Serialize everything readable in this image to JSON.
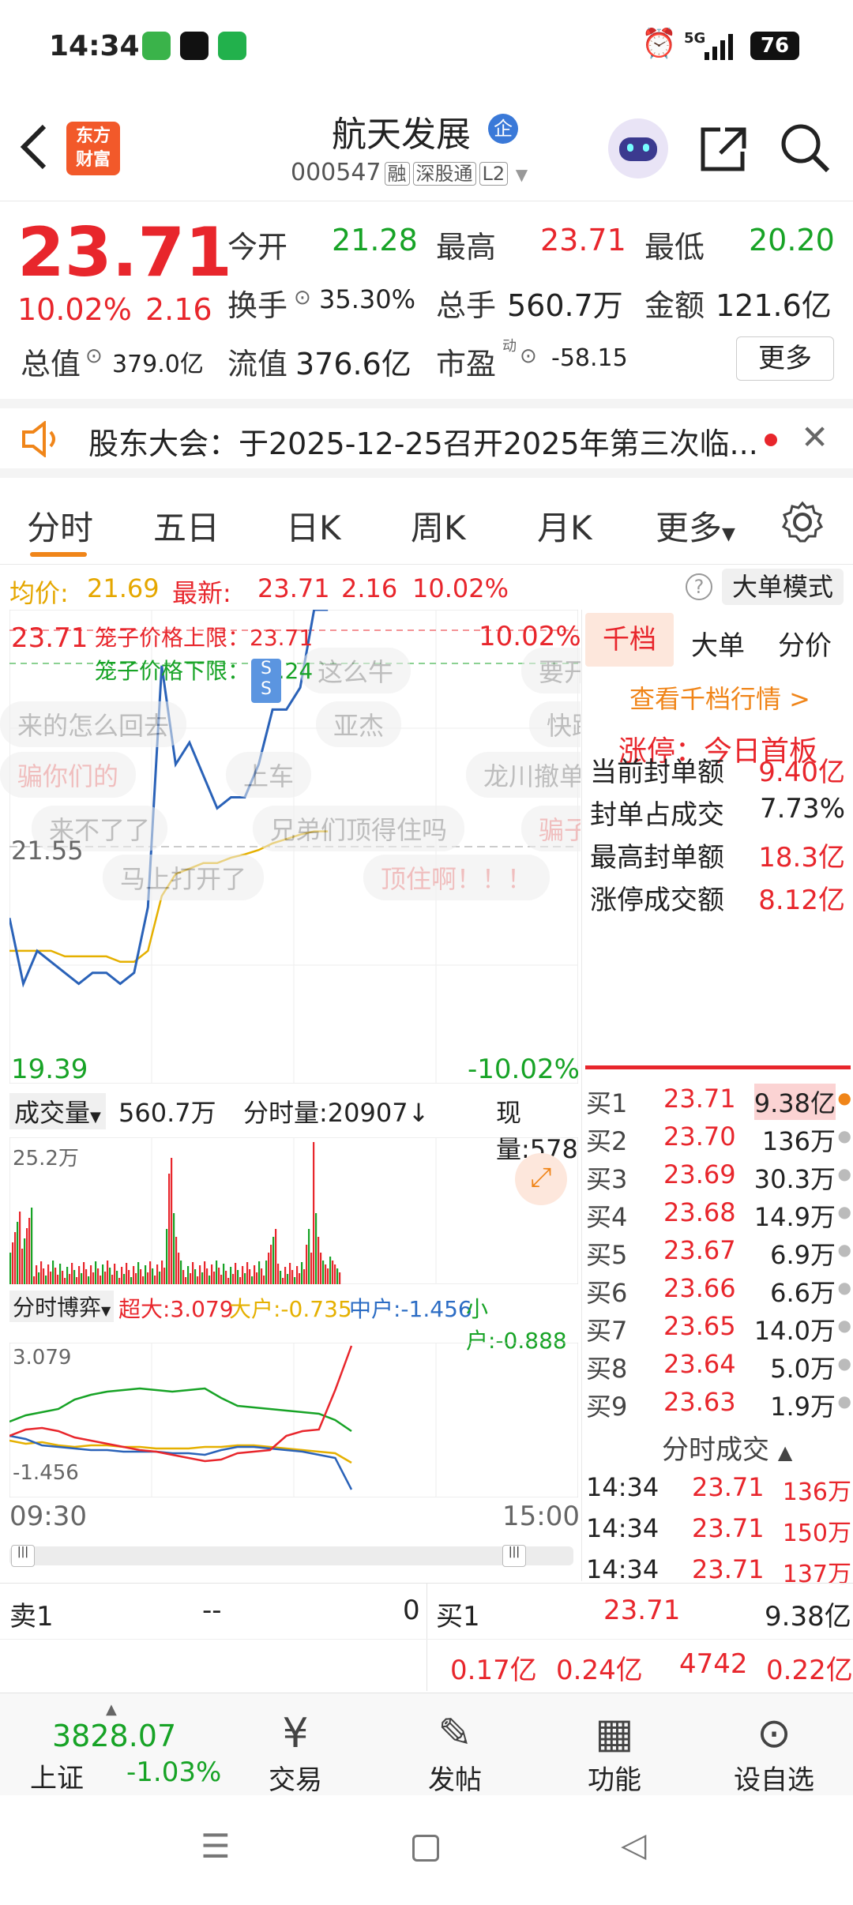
{
  "status_bar": {
    "time": "14:34",
    "network": "5G",
    "battery": "76"
  },
  "header": {
    "title": "航天发展",
    "badge": "企",
    "code": "000547",
    "tags": [
      "融",
      "深股通",
      "L2"
    ],
    "logo_line1": "东方",
    "logo_line2": "财富"
  },
  "quote": {
    "price": "23.71",
    "change_pct": "10.02%",
    "change_amt": "2.16",
    "open_label": "今开",
    "open": "21.28",
    "high_label": "最高",
    "high": "23.71",
    "low_label": "最低",
    "low": "20.20",
    "turnover_label": "换手",
    "turnover": "35.30%",
    "volume_label": "总手",
    "volume": "560.7万",
    "amount_label": "金额",
    "amount": "121.6亿",
    "mcap_label": "总值",
    "mcap": "379.0亿",
    "float_label": "流值",
    "float": "376.6亿",
    "pe_label": "市盈",
    "pe_sup": "动",
    "pe": "-58.15",
    "more": "更多"
  },
  "notice": {
    "text": "股东大会：于2025-12-25召开2025年第三次临..."
  },
  "tabs": [
    "分时",
    "五日",
    "日K",
    "周K",
    "月K",
    "更多"
  ],
  "infobar": {
    "avg_label": "均价:",
    "avg": "21.69",
    "latest_label": "最新:",
    "latest": "23.71",
    "latest_chg": "2.16",
    "latest_pct": "10.02%",
    "mode_button": "大单模式"
  },
  "chart": {
    "top_price": "23.71",
    "top_pct": "10.02%",
    "mid_price": "21.55",
    "bottom_price": "19.39",
    "bottom_pct": "-10.02%",
    "cage_upper": "笼子价格上限：23.71",
    "cage_lower": "笼子价格下限：23.24",
    "danmaku": [
      "这么牛",
      "要开",
      "来的怎么回去",
      "亚杰",
      "快跑",
      "骗你们的",
      "上车",
      "龙川撤单",
      "来不了了",
      "兄弟们顶得住吗",
      "骗子",
      "马上打开了",
      "顶住啊！！！"
    ],
    "volume_label": "成交量",
    "volume_total": "560.7万",
    "tick_vol_label": "分时量:20907↓",
    "now_vol_label": "现量:578",
    "vol_axis_max": "25.2万",
    "flow_label": "分时博弈",
    "flow_super": "超大:3.079",
    "flow_big": "大户:-0.735",
    "flow_mid": "中户:-1.456",
    "flow_small": "小户:-0.888",
    "flow_max": "3.079",
    "flow_min": "-1.456",
    "time_start": "09:30",
    "time_end": "15:00"
  },
  "chart_data": {
    "type": "line",
    "title": "",
    "ylim": [
      19.39,
      23.71
    ],
    "series": [
      {
        "name": "",
        "values": [
          20.9,
          20.3,
          20.6,
          20.5,
          20.4,
          20.3,
          20.4,
          20.4,
          20.3,
          20.4,
          21.0,
          23.2,
          22.3,
          22.5,
          22.2,
          21.9,
          22.0,
          22.0,
          22.3,
          22.8,
          22.8,
          23.0,
          23.71,
          23.71
        ]
      },
      {
        "name": "均价",
        "values": [
          20.6,
          20.6,
          20.6,
          20.6,
          20.55,
          20.55,
          20.55,
          20.55,
          20.5,
          20.5,
          20.6,
          21.1,
          21.3,
          21.35,
          21.4,
          21.4,
          21.45,
          21.48,
          21.52,
          21.58,
          21.62,
          21.66,
          21.69,
          21.69
        ]
      }
    ]
  },
  "side_tabs": [
    "千档",
    "大单",
    "分价"
  ],
  "side": {
    "link": "查看千档行情 >",
    "limit_title": "涨停：今日首板",
    "stats": [
      {
        "label": "当前封单额",
        "value": "9.40亿"
      },
      {
        "label": "封单占成交",
        "value": "7.73%"
      },
      {
        "label": "最高封单额",
        "value": "18.3亿"
      },
      {
        "label": "涨停成交额",
        "value": "8.12亿"
      }
    ],
    "bids": [
      {
        "label": "买1",
        "price": "23.71",
        "vol": "9.38亿"
      },
      {
        "label": "买2",
        "price": "23.70",
        "vol": "136万"
      },
      {
        "label": "买3",
        "price": "23.69",
        "vol": "30.3万"
      },
      {
        "label": "买4",
        "price": "23.68",
        "vol": "14.9万"
      },
      {
        "label": "买5",
        "price": "23.67",
        "vol": "6.9万"
      },
      {
        "label": "买6",
        "price": "23.66",
        "vol": "6.6万"
      },
      {
        "label": "买7",
        "price": "23.65",
        "vol": "14.0万"
      },
      {
        "label": "买8",
        "price": "23.64",
        "vol": "5.0万"
      },
      {
        "label": "买9",
        "price": "23.63",
        "vol": "1.9万"
      }
    ],
    "ticks_title": "分时成交",
    "ticks": [
      {
        "time": "14:34",
        "price": "23.71",
        "vol": "136万"
      },
      {
        "time": "14:34",
        "price": "23.71",
        "vol": "150万"
      },
      {
        "time": "14:34",
        "price": "23.71",
        "vol": "137万"
      }
    ]
  },
  "summary": {
    "sell1_label": "卖1",
    "sell1_price": "--",
    "sell1_vol": "0",
    "buy1_label": "买1",
    "buy1_price": "23.71",
    "buy1_vol": "9.38亿",
    "row2": [
      "0.17亿",
      "0.24亿",
      "4742",
      "0.22亿"
    ]
  },
  "bottom_nav": {
    "index_value": "3828.07",
    "index_name": "上证",
    "index_pct": "-1.03%",
    "items": [
      "交易",
      "发帖",
      "功能",
      "设自选"
    ]
  }
}
